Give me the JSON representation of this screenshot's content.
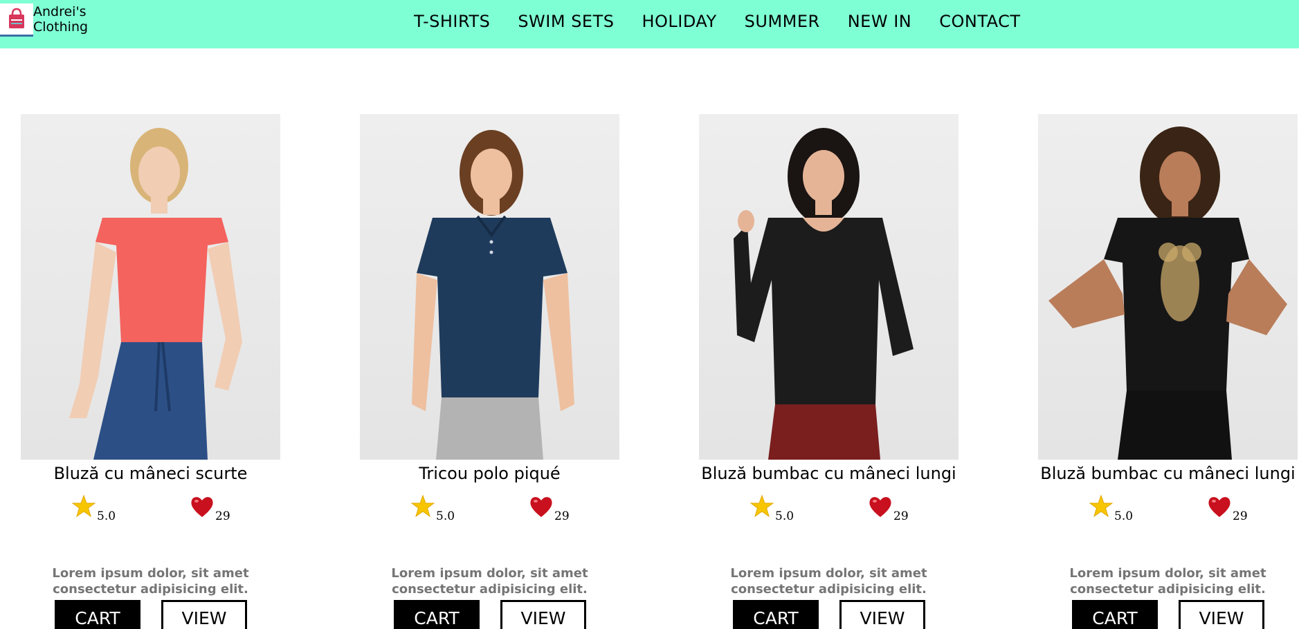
{
  "brand": {
    "name": "Andrei's Clothing",
    "logo_icon": "shopping-bag-icon"
  },
  "nav": {
    "items": [
      "T-SHIRTS",
      "SWIM SETS",
      "HOLIDAY",
      "SUMMER",
      "NEW IN",
      "CONTACT"
    ]
  },
  "colors": {
    "header_bg": "#7fffd4",
    "cart_bg": "#000000",
    "desc_text": "#757575"
  },
  "products": [
    {
      "title": "Bluză cu mâneci scurte",
      "rating": "5.0",
      "likes": "29",
      "description": "Lorem ipsum dolor, sit amet consectetur adipisicing elit.",
      "cart_label": "CART",
      "view_label": "VIEW",
      "top_color": "#f4635e",
      "bottom_color": "#2c4f86"
    },
    {
      "title": "Tricou polo piqué",
      "rating": "5.0",
      "likes": "29",
      "description": "Lorem ipsum dolor, sit amet consectetur adipisicing elit.",
      "cart_label": "CART",
      "view_label": "VIEW",
      "top_color": "#1f3b5c",
      "bottom_color": "#b3b3b3"
    },
    {
      "title": "Bluză bumbac cu mâneci lungi",
      "rating": "5.0",
      "likes": "29",
      "description": "Lorem ipsum dolor, sit amet consectetur adipisicing elit.",
      "cart_label": "CART",
      "view_label": "VIEW",
      "top_color": "#1c1c1c",
      "bottom_color": "#7a1e1e"
    },
    {
      "title": "Bluză bumbac cu mâneci lungi",
      "rating": "5.0",
      "likes": "29",
      "description": "Lorem ipsum dolor, sit amet consectetur adipisicing elit.",
      "cart_label": "CART",
      "view_label": "VIEW",
      "top_color": "#161616",
      "bottom_color": "#111111"
    }
  ]
}
